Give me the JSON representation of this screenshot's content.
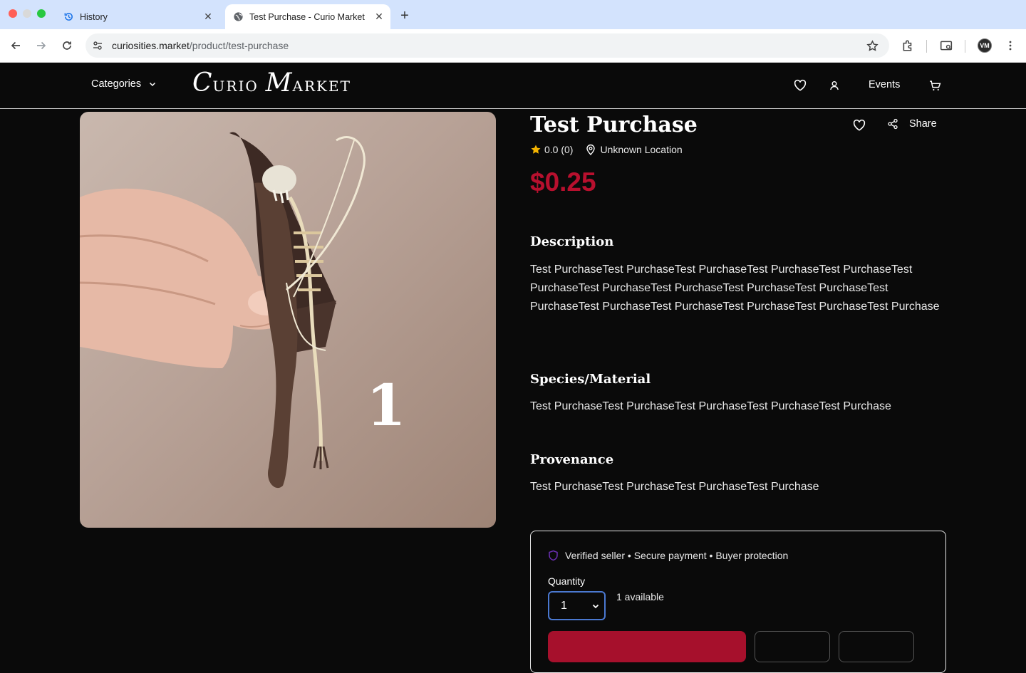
{
  "browser": {
    "tabs": [
      {
        "label": "History",
        "icon": "history-icon"
      },
      {
        "label": "Test Purchase - Curio Market",
        "icon": "globe-icon",
        "active": true
      }
    ],
    "url_domain": "curiosities.market",
    "url_path": "/product/test-purchase",
    "profile_initials": "VM"
  },
  "header": {
    "categories_label": "Categories",
    "logo_first": "C",
    "logo_first_rest": "URIO",
    "logo_second": "M",
    "logo_second_rest": "ARKET",
    "events_label": "Events"
  },
  "product": {
    "image_overlay_number": "1",
    "title": "Test Purchase",
    "share_label": "Share",
    "rating": "0.0 (0)",
    "location": "Unknown Location",
    "price": "$0.25",
    "description_heading": "Description",
    "description": "Test PurchaseTest PurchaseTest PurchaseTest PurchaseTest PurchaseTest PurchaseTest PurchaseTest PurchaseTest PurchaseTest PurchaseTest PurchaseTest PurchaseTest PurchaseTest PurchaseTest PurchaseTest Purchase",
    "species_heading": "Species/Material",
    "species": "Test PurchaseTest PurchaseTest PurchaseTest PurchaseTest Purchase",
    "provenance_heading": "Provenance",
    "provenance": "Test PurchaseTest PurchaseTest PurchaseTest Purchase"
  },
  "purchase": {
    "trust_text": "Verified seller • Secure payment • Buyer protection",
    "quantity_label": "Quantity",
    "quantity_value": "1",
    "available_text": "1 available"
  },
  "colors": {
    "price": "#b8102e",
    "buy_button": "#a6102c",
    "tab_strip": "#d3e3fd"
  }
}
